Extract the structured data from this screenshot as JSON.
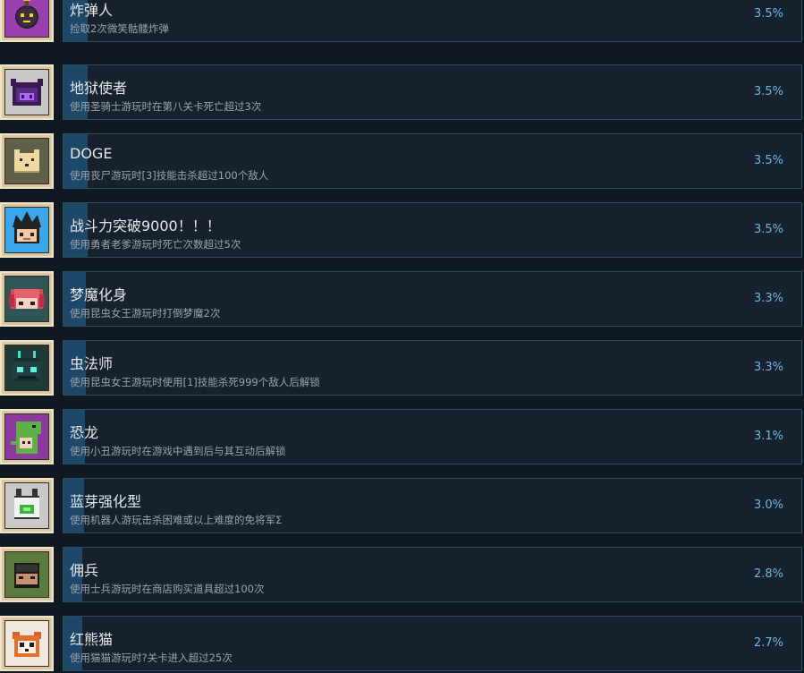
{
  "achievements": [
    {
      "title": "炸弹人",
      "desc": "捡取2次微笑骷髅炸弹",
      "pct": "3.5%",
      "progress": 0.035,
      "icon": "bomb-character-icon",
      "icon_bg": "#9a3fb0"
    },
    {
      "title": "地狱使者",
      "desc": "使用圣骑士游玩时在第八关卡死亡超过3次",
      "pct": "3.5%",
      "progress": 0.035,
      "icon": "purple-demon-icon",
      "icon_bg": "#c8c8c8"
    },
    {
      "title": "DOGE",
      "desc": "使用丧尸游玩时[3]技能击杀超过100个敌人",
      "pct": "3.5%",
      "progress": 0.035,
      "icon": "doge-icon",
      "icon_bg": "#5e6049"
    },
    {
      "title": "战斗力突破9000！！！",
      "desc": "使用勇者老爹游玩时死亡次数超过5次",
      "pct": "3.5%",
      "progress": 0.035,
      "icon": "spiky-hair-hero-icon",
      "icon_bg": "#3aa7e8"
    },
    {
      "title": "梦魔化身",
      "desc": "使用昆虫女王游玩时打倒梦魔2次",
      "pct": "3.3%",
      "progress": 0.033,
      "icon": "red-hair-girl-icon",
      "icon_bg": "#2f5556"
    },
    {
      "title": "虫法师",
      "desc": "使用昆虫女王游玩时使用[1]技能杀死999个敌人后解锁",
      "pct": "3.3%",
      "progress": 0.033,
      "icon": "bug-mage-icon",
      "icon_bg": "#1f3b38"
    },
    {
      "title": "恐龙",
      "desc": "使用小丑游玩时在游戏中遇到后与其互动后解锁",
      "pct": "3.1%",
      "progress": 0.031,
      "icon": "dinosaur-costume-icon",
      "icon_bg": "#8b3aa0"
    },
    {
      "title": "蓝芽强化型",
      "desc": "使用机器人游玩击杀困难或以上难度的免将军Σ",
      "pct": "3.0%",
      "progress": 0.03,
      "icon": "robot-icon",
      "icon_bg": "#c9c9c9"
    },
    {
      "title": "佣兵",
      "desc": "使用士兵游玩时在商店购买道具超过100次",
      "pct": "2.8%",
      "progress": 0.028,
      "icon": "mercenary-icon",
      "icon_bg": "#5b7a3d"
    },
    {
      "title": "红熊猫",
      "desc": "使用猫猫游玩时?关卡进入超过25次",
      "pct": "2.7%",
      "progress": 0.027,
      "icon": "red-panda-icon",
      "icon_bg": "#f0e8dc"
    }
  ]
}
